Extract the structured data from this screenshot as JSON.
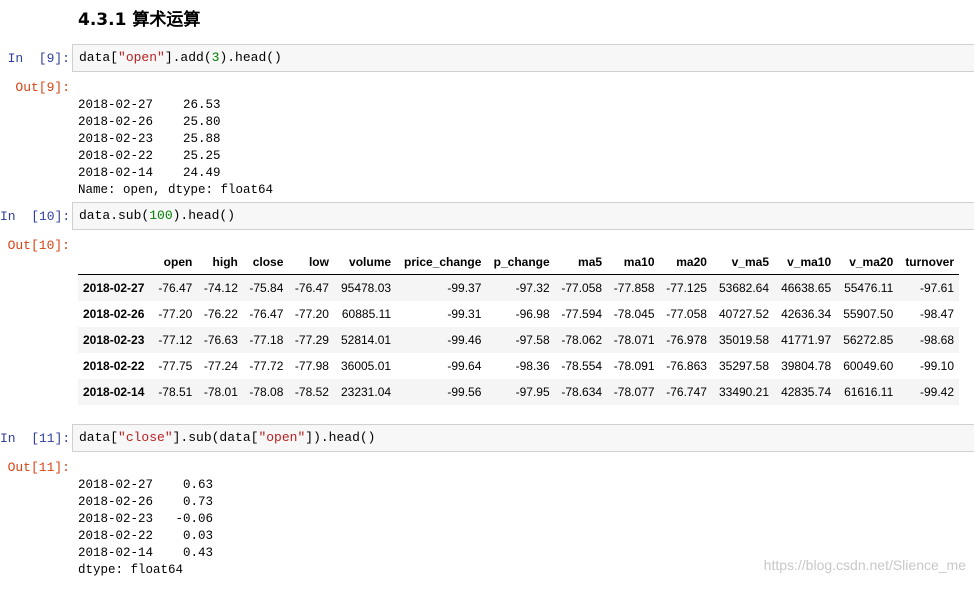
{
  "heading": "4.3.1 算术运算",
  "cells": [
    {
      "in_prompt": "In  [9]:",
      "code_parts": [
        "data[",
        "\"open\"",
        "].add(",
        "3",
        ").head()"
      ],
      "out_prompt": "Out[9]:",
      "output_lines": [
        "2018-02-27    26.53",
        "2018-02-26    25.80",
        "2018-02-23    25.88",
        "2018-02-22    25.25",
        "2018-02-14    24.49",
        "Name: open, dtype: float64"
      ]
    },
    {
      "in_prompt": "In  [10]:",
      "code_parts": [
        "data.sub(",
        "100",
        ").head()"
      ],
      "out_prompt": "Out[10]:"
    },
    {
      "in_prompt": "In  [11]:",
      "code_parts": [
        "data[",
        "\"close\"",
        "].sub(data[",
        "\"open\"",
        "]).head()"
      ],
      "out_prompt": "Out[11]:",
      "output_lines": [
        "2018-02-27    0.63",
        "2018-02-26    0.73",
        "2018-02-23   -0.06",
        "2018-02-22    0.03",
        "2018-02-14    0.43",
        "dtype: float64"
      ]
    }
  ],
  "table": {
    "columns": [
      "",
      "open",
      "high",
      "close",
      "low",
      "volume",
      "price_change",
      "p_change",
      "ma5",
      "ma10",
      "ma20",
      "v_ma5",
      "v_ma10",
      "v_ma20",
      "turnover"
    ],
    "rows": [
      [
        "2018-02-27",
        "-76.47",
        "-74.12",
        "-75.84",
        "-76.47",
        "95478.03",
        "-99.37",
        "-97.32",
        "-77.058",
        "-77.858",
        "-77.125",
        "53682.64",
        "46638.65",
        "55476.11",
        "-97.61"
      ],
      [
        "2018-02-26",
        "-77.20",
        "-76.22",
        "-76.47",
        "-77.20",
        "60885.11",
        "-99.31",
        "-96.98",
        "-77.594",
        "-78.045",
        "-77.058",
        "40727.52",
        "42636.34",
        "55907.50",
        "-98.47"
      ],
      [
        "2018-02-23",
        "-77.12",
        "-76.63",
        "-77.18",
        "-77.29",
        "52814.01",
        "-99.46",
        "-97.58",
        "-78.062",
        "-78.071",
        "-76.978",
        "35019.58",
        "41771.97",
        "56272.85",
        "-98.68"
      ],
      [
        "2018-02-22",
        "-77.75",
        "-77.24",
        "-77.72",
        "-77.98",
        "36005.01",
        "-99.64",
        "-98.36",
        "-78.554",
        "-78.091",
        "-76.863",
        "35297.58",
        "39804.78",
        "60049.60",
        "-99.10"
      ],
      [
        "2018-02-14",
        "-78.51",
        "-78.01",
        "-78.08",
        "-78.52",
        "23231.04",
        "-99.56",
        "-97.95",
        "-78.634",
        "-78.077",
        "-76.747",
        "33490.21",
        "42835.74",
        "61616.11",
        "-99.42"
      ]
    ]
  },
  "watermark": "https://blog.csdn.net/Slience_me"
}
